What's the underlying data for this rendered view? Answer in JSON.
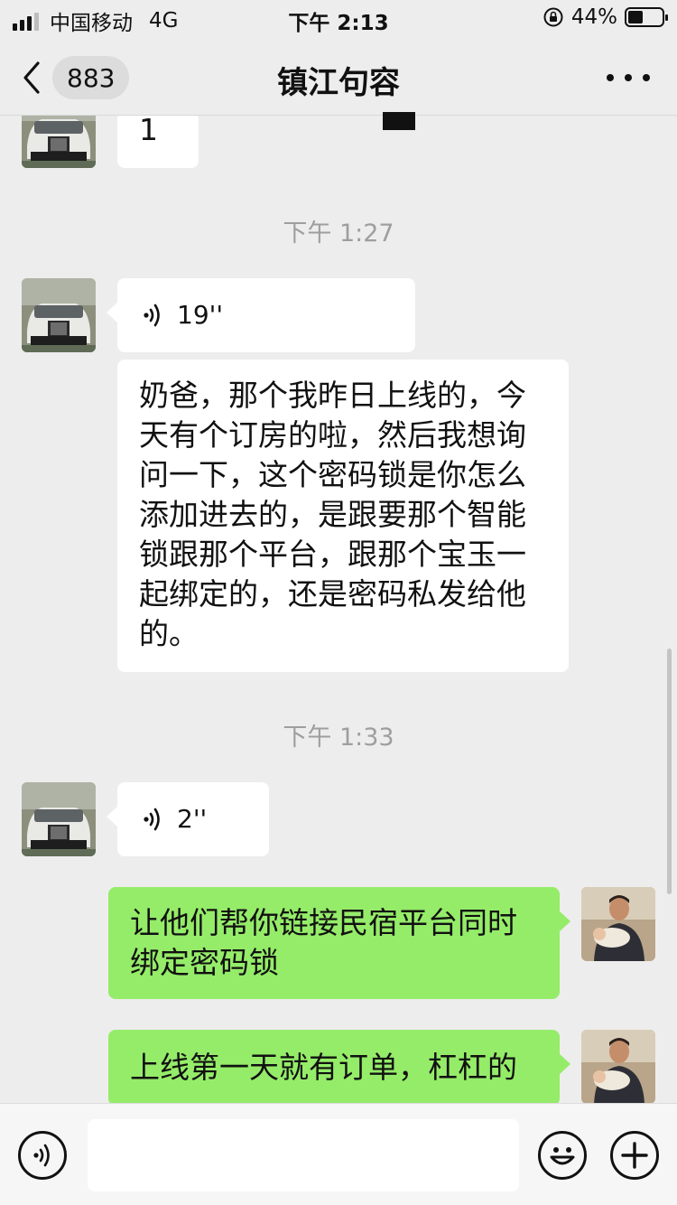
{
  "status_bar": {
    "carrier": "中国移动",
    "network": "4G",
    "time": "下午 2:13",
    "battery": "44%",
    "battery_level": 0.44
  },
  "nav": {
    "unread_count": "883",
    "title": "镇江句容"
  },
  "messages": [
    {
      "type": "text",
      "side": "in",
      "text": "1"
    },
    {
      "type": "time",
      "text": "下午 1:27"
    },
    {
      "type": "voice",
      "side": "in",
      "duration": "19''"
    },
    {
      "type": "text",
      "side": "in",
      "lines": [
        "奶爸，那个我昨日上线的，今",
        "天有个订房的啦，然后我想询",
        "问一下，这个密码锁是你怎么",
        "添加进去的，是跟要那个智能",
        "锁跟那个平台，跟那个宝玉一",
        "起绑定的，还是密码私发给他",
        "的。"
      ]
    },
    {
      "type": "time",
      "text": "下午 1:33"
    },
    {
      "type": "voice",
      "side": "in",
      "duration": "2''"
    },
    {
      "type": "text",
      "side": "out",
      "lines": [
        "让他们帮你链接民宿平台同时",
        "绑定密码锁"
      ]
    },
    {
      "type": "text",
      "side": "out",
      "text": "上线第一天就有订单，杠杠的"
    }
  ],
  "colors": {
    "background": "#ededed",
    "incoming_bubble": "#ffffff",
    "outgoing_bubble": "#95ec69",
    "timestamp": "#9e9e9e"
  },
  "icons": {
    "back": "chevron-left-icon",
    "more": "more-dots-icon",
    "voice_mode": "voice-mode-icon",
    "emoji": "emoji-icon",
    "add": "plus-icon"
  }
}
